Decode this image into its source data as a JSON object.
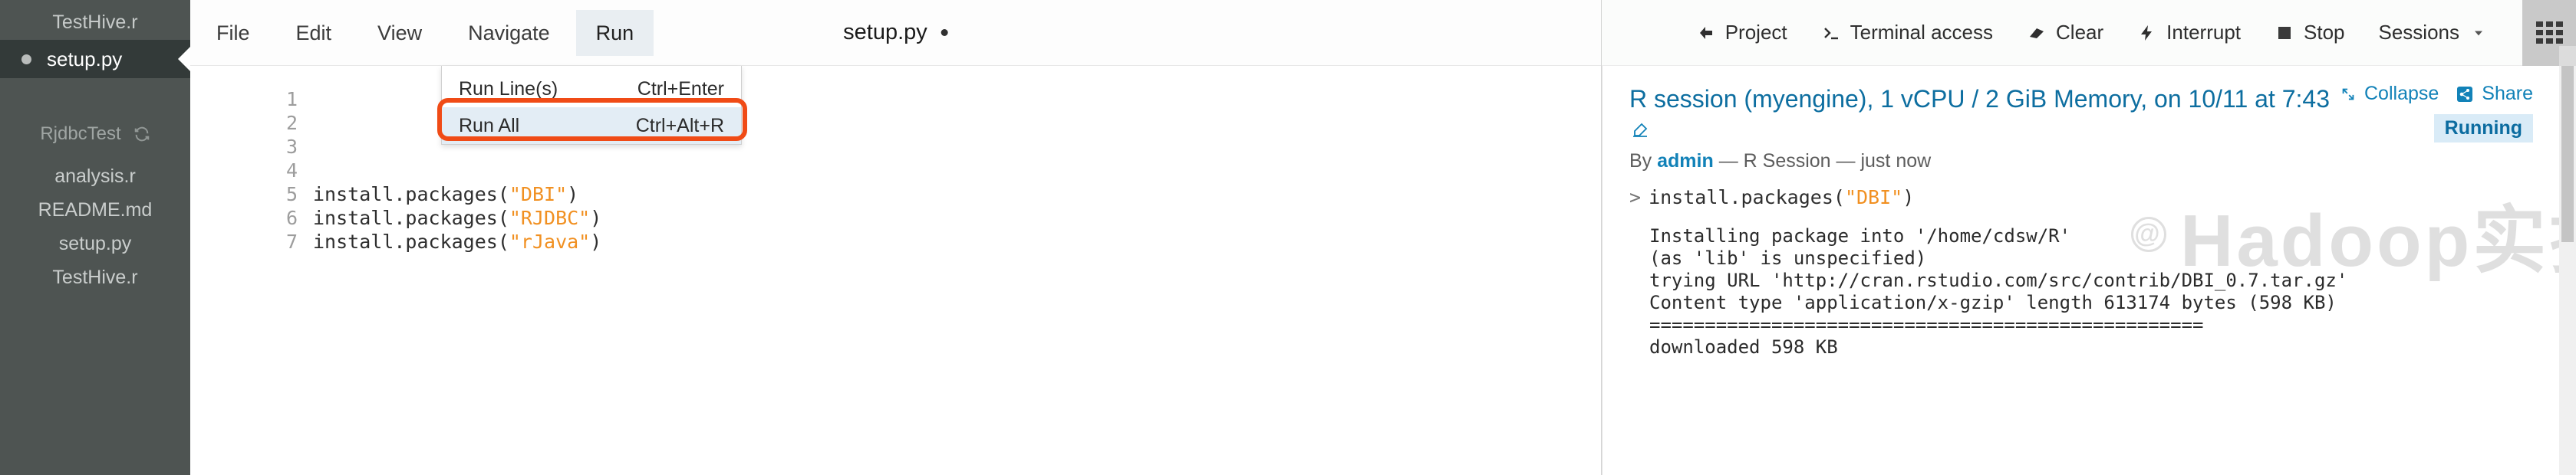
{
  "sidebar": {
    "top_file": "TestHive.r",
    "active_file": "setup.py",
    "project_name": "RjdbcTest",
    "refresh_icon": "refresh-icon",
    "files": [
      "analysis.r",
      "README.md",
      "setup.py",
      "TestHive.r"
    ]
  },
  "menubar": {
    "items": [
      {
        "label": "File",
        "active": false
      },
      {
        "label": "Edit",
        "active": false
      },
      {
        "label": "View",
        "active": false
      },
      {
        "label": "Navigate",
        "active": false
      },
      {
        "label": "Run",
        "active": true
      }
    ],
    "tab_title": "setup.py"
  },
  "run_menu": {
    "items": [
      {
        "label": "Run Line(s)",
        "shortcut": "Ctrl+Enter",
        "highlighted": false
      },
      {
        "label": "Run All",
        "shortcut": "Ctrl+Alt+R",
        "highlighted": true
      }
    ],
    "highlight_color": "#f04b16"
  },
  "editor": {
    "lines": [
      {
        "no": "1",
        "pre": "",
        "str": "",
        "post": ""
      },
      {
        "no": "2",
        "pre": "",
        "str": "",
        "post": ""
      },
      {
        "no": "3",
        "pre": "",
        "str": "",
        "post": ""
      },
      {
        "no": "4",
        "pre": "",
        "str": "",
        "post": ""
      },
      {
        "no": "5",
        "pre": "install.packages(",
        "str": "\"DBI\"",
        "post": ")"
      },
      {
        "no": "6",
        "pre": "install.packages(",
        "str": "\"RJDBC\"",
        "post": ")"
      },
      {
        "no": "7",
        "pre": "install.packages(",
        "str": "\"rJava\"",
        "post": ")"
      }
    ]
  },
  "console_toolbar": {
    "buttons": [
      {
        "label": "Project",
        "icon": "arrow-left-icon"
      },
      {
        "label": "Terminal access",
        "icon": "terminal-icon"
      },
      {
        "label": "Clear",
        "icon": "eraser-icon"
      },
      {
        "label": "Interrupt",
        "icon": "lightning-icon"
      },
      {
        "label": "Stop",
        "icon": "stop-square-icon"
      },
      {
        "label": "Sessions",
        "icon": "chevron-down-icon"
      }
    ],
    "grid_button": "grid-icon"
  },
  "console": {
    "session_title": "R session (myengine), 1 vCPU / 2 GiB Memory, on 10/11 at 7:43",
    "collapse_label": "Collapse",
    "share_label": "Share",
    "status_badge": "Running",
    "byline_prefix": "By ",
    "byline_user": "admin",
    "byline_suffix": " — R Session — just now",
    "prompt_chevron": ">",
    "prompt_pre": "install.packages(",
    "prompt_str": "\"DBI\"",
    "prompt_post": ")",
    "output": "Installing package into '/home/cdsw/R'\n(as 'lib' is unspecified)\ntrying URL 'http://cran.rstudio.com/src/contrib/DBI_0.7.tar.gz'\nContent type 'application/x-gzip' length 613174 bytes (598 KB)\n==================================================\ndownloaded 598 KB",
    "watermark": "Hadoop实操",
    "accent_color": "#0d6ea0",
    "string_color": "#f19021"
  }
}
